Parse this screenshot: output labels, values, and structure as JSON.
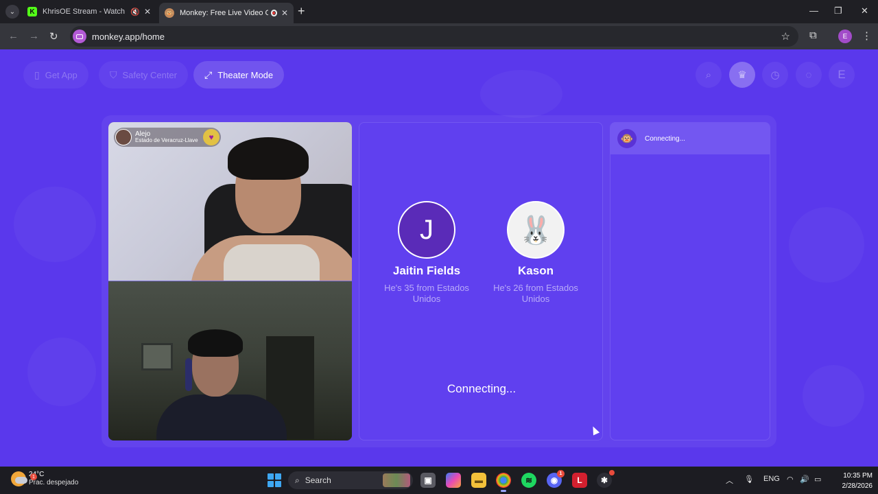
{
  "browser": {
    "tabs": [
      {
        "title": "KhrisOE Stream - Watch Live",
        "favicon": "K",
        "active": false
      },
      {
        "title": "Monkey: Free Live Video Chat",
        "favicon": "monkey-face-icon",
        "active": true
      }
    ],
    "url": "monkey.app/home",
    "profile_initial": "E"
  },
  "header": {
    "get_app": "Get App",
    "safety_center": "Safety Center",
    "theater_mode": "Theater Mode",
    "profile_initial": "E"
  },
  "video": {
    "user_name": "Alejo",
    "user_location": "Estado de Veracruz-Llave"
  },
  "match": {
    "candidates": [
      {
        "initial": "J",
        "name": "Jaitin Fields",
        "sub": "He's 35 from Estados Unidos"
      },
      {
        "avatar": "bunny-avatar",
        "name": "Kason",
        "sub": "He's 26 from Estados Unidos"
      }
    ],
    "status": "Connecting..."
  },
  "chat": {
    "status": "Connecting..."
  },
  "taskbar": {
    "weather_temp": "24°C",
    "weather_cond": "Prac. despejado",
    "weather_badge": "1",
    "search": "Search",
    "discord_badge": "1",
    "lang": "ENG",
    "time": "10:35 PM",
    "date": "2/28/2026"
  },
  "colors": {
    "page_bg": "#5a38ec",
    "panel_bg": "#6040ef",
    "chrome_bg": "#1f1f24"
  }
}
